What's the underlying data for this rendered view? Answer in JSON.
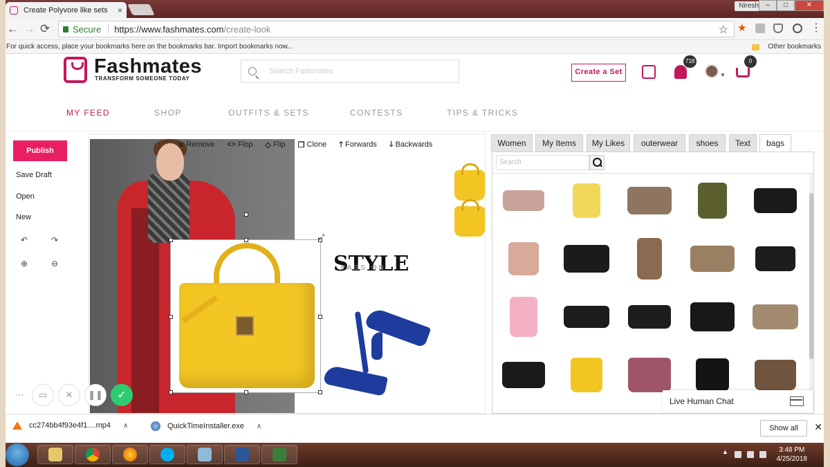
{
  "browser": {
    "tab_title": "Create Polyvore like sets",
    "tab_close": "×",
    "user_name": "Niresh",
    "url_secure": "Secure",
    "url_base": "https://www.fashmates.com",
    "url_path": "/create-look",
    "bookmarks_hint": "For quick access, place your bookmarks here on the bookmarks bar.",
    "bookmarks_link": "Import bookmarks now...",
    "other_bookmarks": "Other bookmarks",
    "win_min": "–",
    "win_max": "□",
    "win_close": "✕"
  },
  "site": {
    "brand": "Fashmates",
    "tagline": "TRANSFORM SOMEONE TODAY",
    "search_placeholder": "Search Fashmates",
    "create_set": "Create a Set",
    "notifications_count": "718",
    "cart_count": "0"
  },
  "nav": [
    {
      "label": "MY FEED",
      "active": true
    },
    {
      "label": "SHOP"
    },
    {
      "label": "OUTFITS & SETS"
    },
    {
      "label": "CONTESTS"
    },
    {
      "label": "TIPS & TRICKS"
    }
  ],
  "rail": {
    "publish": "Publish",
    "save_draft": "Save Draft",
    "open": "Open",
    "new": "New"
  },
  "toolbar": [
    {
      "icon": "✕",
      "label": "Remove"
    },
    {
      "icon": "<>",
      "label": "Flop"
    },
    {
      "icon": "◇",
      "label": "Flip"
    },
    {
      "icon": "❐",
      "label": "Clone"
    },
    {
      "icon": "🡑",
      "label": "Forwards"
    },
    {
      "icon": "🡓",
      "label": "Backwards"
    }
  ],
  "canvas": {
    "style_word": "STYLE",
    "style_sub": "PASS ON"
  },
  "panel": {
    "tabs": [
      {
        "label": "Women"
      },
      {
        "label": "My Items"
      },
      {
        "label": "My Likes"
      },
      {
        "label": "outerwear"
      },
      {
        "label": "shoes"
      },
      {
        "label": "Text"
      },
      {
        "label": "bags",
        "active": true
      }
    ],
    "search_placeholder": "Search",
    "chat_label": "Live Human Chat",
    "items": [
      {
        "name": "pink-gg-bag-icon",
        "color": "#c9a29a"
      },
      {
        "name": "round-yellow-bag-icon",
        "color": "#f1d85a"
      },
      {
        "name": "gg-canvas-bag-icon",
        "color": "#8d7560"
      },
      {
        "name": "olive-tote-icon",
        "color": "#5b5f2e"
      },
      {
        "name": "black-ysl-wallet-icon",
        "color": "#1a1a1a"
      },
      {
        "name": "round-pink-bag-icon",
        "color": "#d7aa9a"
      },
      {
        "name": "black-gg-flap-bag-icon",
        "color": "#1b1b1b"
      },
      {
        "name": "model-crossbody-icon",
        "color": "#8a6a52"
      },
      {
        "name": "gg-supreme-shoulder-icon",
        "color": "#9a8062"
      },
      {
        "name": "black-gg-clutch-icon",
        "color": "#1c1c1c"
      },
      {
        "name": "pink-print-tote-icon",
        "color": "#f5b1c3"
      },
      {
        "name": "black-belt-bag-icon",
        "color": "#1c1c1c"
      },
      {
        "name": "black-gg-chain-bag-icon",
        "color": "#1d1d1d"
      },
      {
        "name": "black-camera-bag-icon",
        "color": "#181818"
      },
      {
        "name": "gg-belt-bag-icon",
        "color": "#a28b6f"
      },
      {
        "name": "black-quilted-bag-icon",
        "color": "#1a1a1a"
      },
      {
        "name": "yellow-tote-icon",
        "color": "#f2c522"
      },
      {
        "name": "floral-clutch-icon",
        "color": "#a1556b"
      },
      {
        "name": "black-shopper-icon",
        "color": "#141414"
      },
      {
        "name": "monogram-speedy-icon",
        "color": "#6f5540"
      }
    ]
  },
  "downloads": [
    {
      "name": "cc274bb4f93e4f1....mp4"
    },
    {
      "name": "QuickTimeInstaller.exe"
    }
  ],
  "show_all": "Show all",
  "taskbar": {
    "time": "3:48 PM",
    "date": "4/25/2018"
  },
  "colors": {
    "brand": "#c2185b",
    "publish": "#e91e63"
  }
}
